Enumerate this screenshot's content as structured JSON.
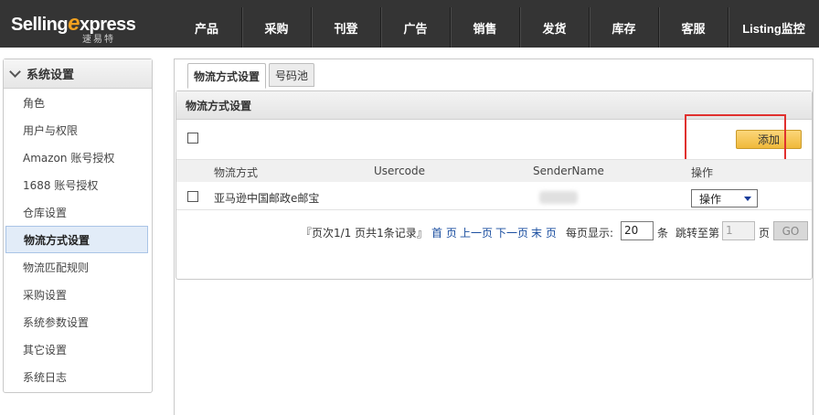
{
  "header": {
    "logo_main": "Selling",
    "logo_x": "e",
    "logo_rest": "xpress",
    "logo_sub": "速易特",
    "nav": [
      {
        "label": "产品"
      },
      {
        "label": "采购"
      },
      {
        "label": "刊登"
      },
      {
        "label": "广告"
      },
      {
        "label": "销售"
      },
      {
        "label": "发货"
      },
      {
        "label": "库存"
      },
      {
        "label": "客服"
      },
      {
        "label": "Listing监控"
      }
    ]
  },
  "sidebar": {
    "title": "系统设置",
    "items": [
      {
        "label": "角色"
      },
      {
        "label": "用户与权限"
      },
      {
        "label": "Amazon 账号授权"
      },
      {
        "label": "1688 账号授权"
      },
      {
        "label": "仓库设置"
      },
      {
        "label": "物流方式设置",
        "active": true
      },
      {
        "label": "物流匹配规则"
      },
      {
        "label": "采购设置"
      },
      {
        "label": "系统参数设置"
      },
      {
        "label": "其它设置"
      },
      {
        "label": "系统日志"
      }
    ]
  },
  "tabs": [
    {
      "label": "物流方式设置",
      "active": true
    },
    {
      "label": "号码池"
    }
  ],
  "panel": {
    "title": "物流方式设置",
    "add_label": "添加",
    "columns": [
      "物流方式",
      "Usercode",
      "SenderName",
      "操作"
    ],
    "rows": [
      {
        "method": "亚马逊中国邮政e邮宝",
        "usercode": "",
        "sender": "",
        "action": "操作"
      }
    ]
  },
  "pager": {
    "summary": "『页次1/1   页共1条记录』",
    "first": "首 页",
    "prev": "上一页",
    "next": "下一页",
    "last": "末 页",
    "per_page_label": "每页显示:",
    "per_page_value": "20",
    "per_page_unit": "条",
    "jump_label": "跳转至第",
    "jump_value": "1",
    "jump_unit": "页",
    "go_label": "GO"
  },
  "colors": {
    "header_bg": "#343434",
    "accent": "#f0a020",
    "highlight_border": "#e0302e",
    "link": "#1a4ea0"
  }
}
